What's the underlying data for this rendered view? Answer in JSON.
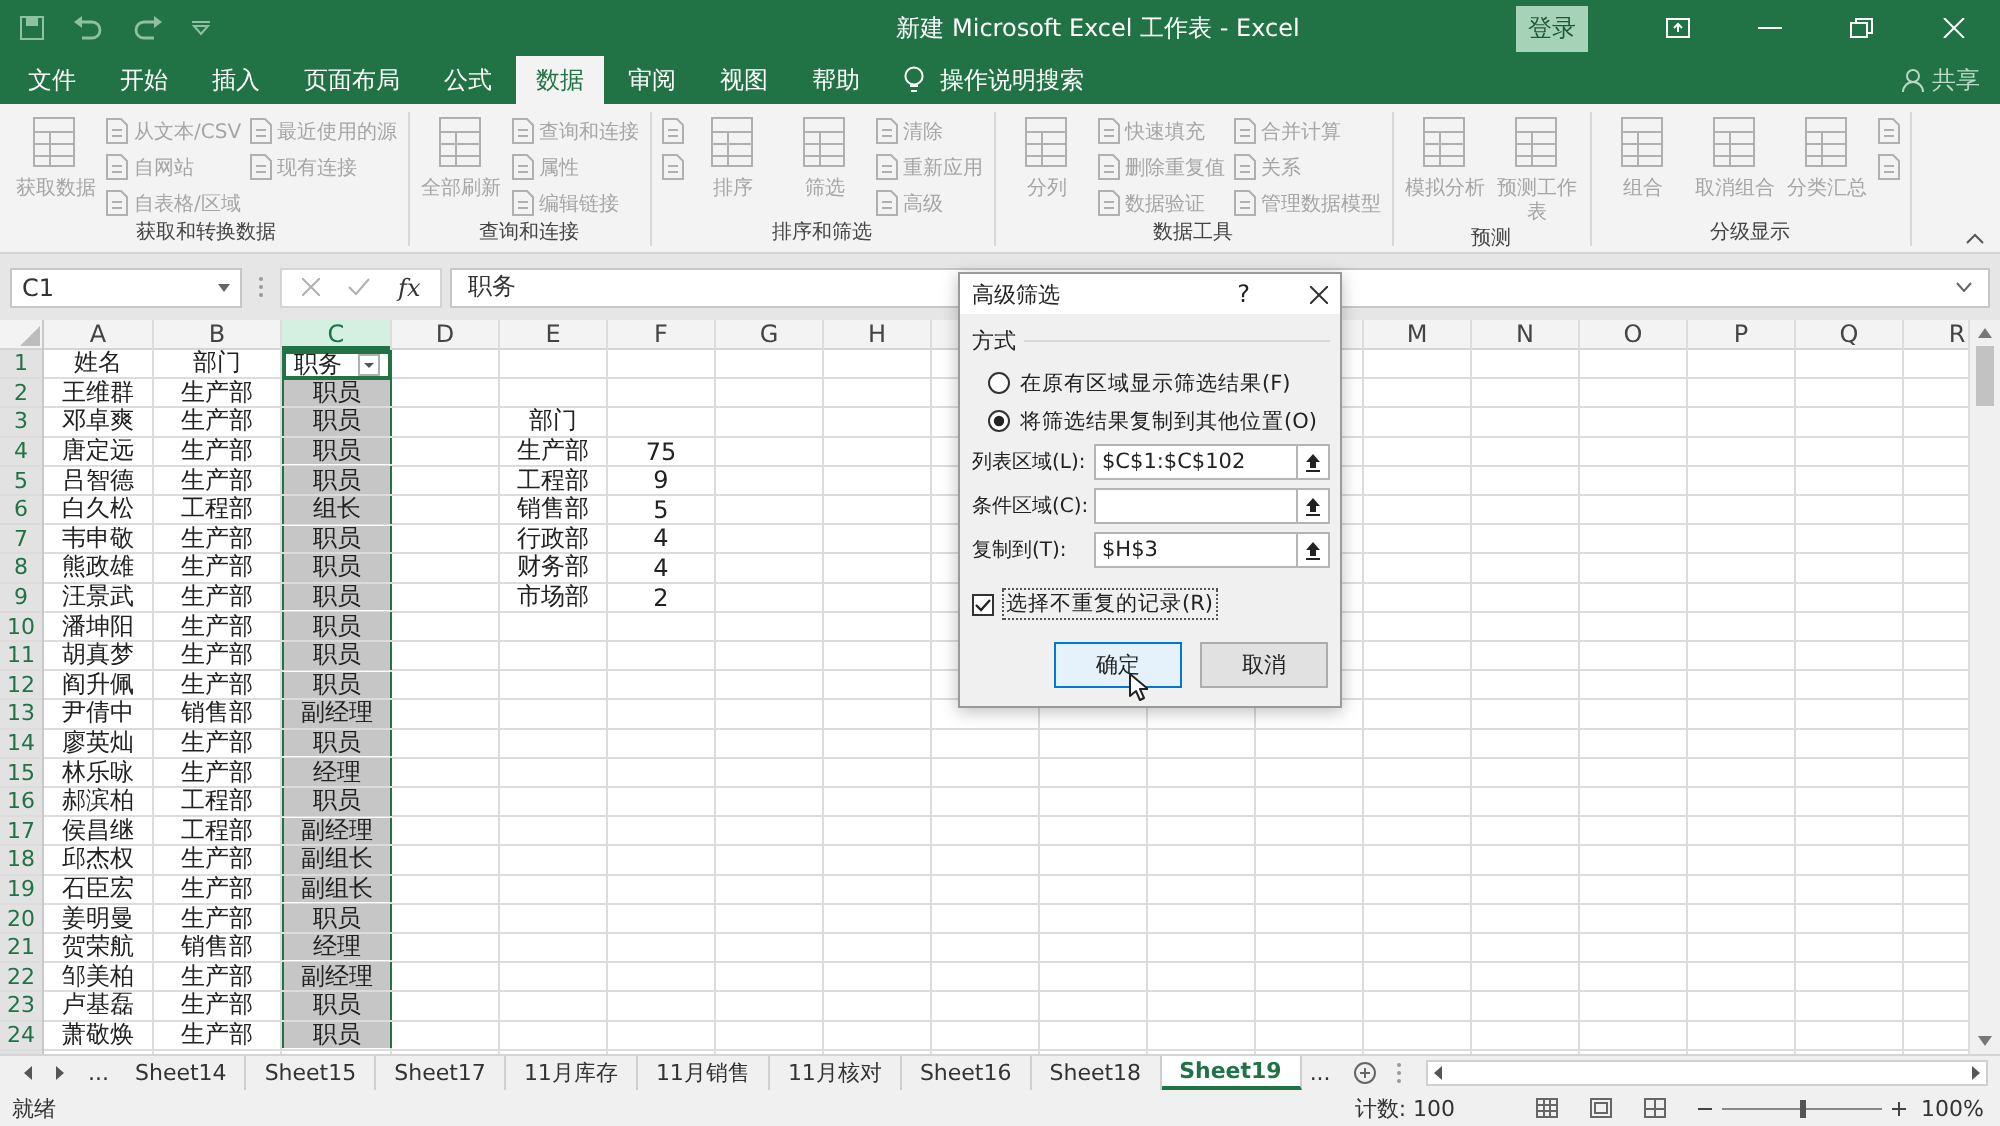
{
  "title_bar": {
    "title": "新建 Microsoft Excel 工作表 - Excel",
    "sign_in": "登录"
  },
  "ribbon_tabs": [
    {
      "label": "文件",
      "selected": false
    },
    {
      "label": "开始",
      "selected": false
    },
    {
      "label": "插入",
      "selected": false
    },
    {
      "label": "页面布局",
      "selected": false
    },
    {
      "label": "公式",
      "selected": false
    },
    {
      "label": "数据",
      "selected": true
    },
    {
      "label": "审阅",
      "selected": false
    },
    {
      "label": "视图",
      "selected": false
    },
    {
      "label": "帮助",
      "selected": false
    }
  ],
  "tell_me": "操作说明搜索",
  "share": "共享",
  "ribbon": {
    "disabled": true,
    "groups": [
      {
        "label": "获取和转换数据",
        "commands": [
          {
            "kind": "large",
            "label": "获取数据"
          },
          {
            "kind": "small",
            "label": "从文本/CSV"
          },
          {
            "kind": "small",
            "label": "自网站"
          },
          {
            "kind": "small",
            "label": "自表格/区域"
          },
          {
            "kind": "small",
            "label": "最近使用的源"
          },
          {
            "kind": "small",
            "label": "现有连接"
          }
        ]
      },
      {
        "label": "查询和连接",
        "commands": [
          {
            "kind": "large",
            "label": "全部刷新"
          },
          {
            "kind": "small",
            "label": "查询和连接"
          },
          {
            "kind": "small",
            "label": "属性"
          },
          {
            "kind": "small",
            "label": "编辑链接"
          }
        ]
      },
      {
        "label": "排序和筛选",
        "commands": [
          {
            "kind": "icon"
          },
          {
            "kind": "icon"
          },
          {
            "kind": "large",
            "label": "排序"
          },
          {
            "kind": "large",
            "label": "筛选"
          },
          {
            "kind": "small",
            "label": "清除"
          },
          {
            "kind": "small",
            "label": "重新应用"
          },
          {
            "kind": "small",
            "label": "高级"
          }
        ]
      },
      {
        "label": "数据工具",
        "commands": [
          {
            "kind": "large",
            "label": "分列"
          },
          {
            "kind": "small",
            "label": "快速填充"
          },
          {
            "kind": "small",
            "label": "删除重复值"
          },
          {
            "kind": "small",
            "label": "数据验证"
          },
          {
            "kind": "small",
            "label": "合并计算"
          },
          {
            "kind": "small",
            "label": "关系"
          },
          {
            "kind": "small",
            "label": "管理数据模型"
          }
        ]
      },
      {
        "label": "预测",
        "commands": [
          {
            "kind": "large",
            "label": "模拟分析"
          },
          {
            "kind": "large",
            "label": "预测工作表"
          }
        ]
      },
      {
        "label": "分级显示",
        "commands": [
          {
            "kind": "large",
            "label": "组合"
          },
          {
            "kind": "large",
            "label": "取消组合"
          },
          {
            "kind": "large",
            "label": "分类汇总"
          },
          {
            "kind": "icon"
          },
          {
            "kind": "icon"
          }
        ]
      }
    ]
  },
  "formula_bar": {
    "name_box": "C1",
    "function_label": "fx",
    "formula": "职务"
  },
  "sheet": {
    "columns": [
      {
        "label": "A",
        "selected": false
      },
      {
        "label": "B",
        "selected": false
      },
      {
        "label": "C",
        "selected": true
      },
      {
        "label": "D",
        "selected": false
      },
      {
        "label": "E",
        "selected": false
      },
      {
        "label": "F",
        "selected": false
      },
      {
        "label": "G",
        "selected": false
      },
      {
        "label": "H",
        "selected": false
      },
      {},
      {},
      {},
      {},
      {
        "label": "M",
        "selected": false
      },
      {
        "label": "N",
        "selected": false
      },
      {
        "label": "O",
        "selected": false
      },
      {
        "label": "P",
        "selected": false
      },
      {
        "label": "Q",
        "selected": false
      },
      {
        "label": "R",
        "selected": false
      }
    ],
    "rows": [
      {
        "number": "1",
        "cells": [
          "姓名",
          "部门",
          {
            "text": "职务",
            "active": true,
            "filter": true
          }
        ]
      },
      {
        "number": "2",
        "cells": [
          "王维群",
          "生产部",
          "职员"
        ]
      },
      {
        "number": "3",
        "cells": [
          "邓卓爽",
          "生产部",
          "职员",
          "",
          "部门"
        ]
      },
      {
        "number": "4",
        "cells": [
          "唐定远",
          "生产部",
          "职员",
          "",
          "生产部",
          "75"
        ]
      },
      {
        "number": "5",
        "cells": [
          "吕智德",
          "生产部",
          "职员",
          "",
          "工程部",
          "9"
        ]
      },
      {
        "number": "6",
        "cells": [
          "白久松",
          "工程部",
          "组长",
          "",
          "销售部",
          "5"
        ]
      },
      {
        "number": "7",
        "cells": [
          "韦申敬",
          "生产部",
          "职员",
          "",
          "行政部",
          "4"
        ]
      },
      {
        "number": "8",
        "cells": [
          "熊政雄",
          "生产部",
          "职员",
          "",
          "财务部",
          "4"
        ]
      },
      {
        "number": "9",
        "cells": [
          "汪景武",
          "生产部",
          "职员",
          "",
          "市场部",
          "2"
        ]
      },
      {
        "number": "10",
        "cells": [
          "潘坤阳",
          "生产部",
          "职员"
        ]
      },
      {
        "number": "11",
        "cells": [
          "胡真梦",
          "生产部",
          "职员"
        ]
      },
      {
        "number": "12",
        "cells": [
          "阎升佩",
          "生产部",
          "职员"
        ]
      },
      {
        "number": "13",
        "cells": [
          "尹倩中",
          "销售部",
          "副经理"
        ]
      },
      {
        "number": "14",
        "cells": [
          "廖英灿",
          "生产部",
          "职员"
        ]
      },
      {
        "number": "15",
        "cells": [
          "林乐咏",
          "生产部",
          "经理"
        ]
      },
      {
        "number": "16",
        "cells": [
          "郝滨柏",
          "工程部",
          "职员"
        ]
      },
      {
        "number": "17",
        "cells": [
          "侯昌继",
          "工程部",
          "副经理"
        ]
      },
      {
        "number": "18",
        "cells": [
          "邱杰权",
          "生产部",
          "副组长"
        ]
      },
      {
        "number": "19",
        "cells": [
          "石臣宏",
          "生产部",
          "副组长"
        ]
      },
      {
        "number": "20",
        "cells": [
          "姜明曼",
          "生产部",
          "职员"
        ]
      },
      {
        "number": "21",
        "cells": [
          "贺荣航",
          "销售部",
          "经理"
        ]
      },
      {
        "number": "22",
        "cells": [
          "邹美柏",
          "生产部",
          "副经理"
        ]
      },
      {
        "number": "23",
        "cells": [
          "卢基磊",
          "生产部",
          "职员"
        ]
      },
      {
        "number": "24",
        "cells": [
          "萧敬焕",
          "生产部",
          "职员"
        ]
      }
    ]
  },
  "dialog": {
    "title": "高级筛选",
    "help": "?",
    "section": "方式",
    "options": [
      {
        "label": "在原有区域显示筛选结果(F)",
        "selected": false
      },
      {
        "label": "将筛选结果复制到其他位置(O)",
        "selected": true
      }
    ],
    "fields": [
      {
        "label": "列表区域(L):",
        "value": "$C$1:$C$102"
      },
      {
        "label": "条件区域(C):"
      },
      {
        "label": "复制到(T):",
        "value": "$H$3"
      }
    ],
    "unique": {
      "label": "选择不重复的记录(R)",
      "checked": true
    },
    "buttons": [
      {
        "label": "确定",
        "default": true
      },
      {
        "label": "取消",
        "default": false
      }
    ]
  },
  "sheet_tabs": {
    "overflow_left": "...",
    "overflow_right": "...",
    "tabs": [
      {
        "label": "Sheet14",
        "selected": false
      },
      {
        "label": "Sheet15",
        "selected": false
      },
      {
        "label": "Sheet17",
        "selected": false
      },
      {
        "label": "11月库存",
        "selected": false
      },
      {
        "label": "11月销售",
        "selected": false
      },
      {
        "label": "11月核对",
        "selected": false
      },
      {
        "label": "Sheet16",
        "selected": false
      },
      {
        "label": "Sheet18",
        "selected": false
      },
      {
        "label": "Sheet19",
        "selected": true
      }
    ]
  },
  "status_bar": {
    "status": "就绪",
    "count": "计数: 100",
    "zoom": {
      "level": 0.5,
      "label": "100%"
    }
  }
}
